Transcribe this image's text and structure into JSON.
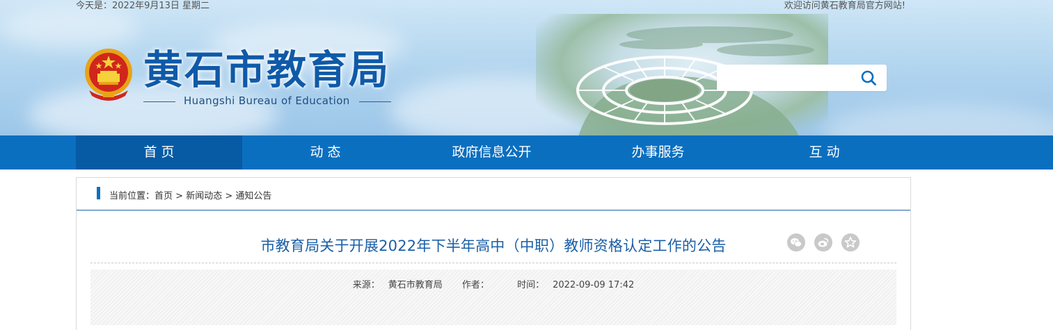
{
  "header": {
    "date_text": "今天是：2022年9月13日 星期二",
    "welcome_text": "欢迎访问黄石教育局官方网站!",
    "site_title": "黄石市教育局",
    "site_subtitle": "Huangshi Bureau of Education",
    "search": {
      "placeholder": "",
      "value": "",
      "icon": "search-icon"
    },
    "emblem_icon": "national-emblem-icon"
  },
  "nav": {
    "items": [
      {
        "label": "首 页",
        "active": true
      },
      {
        "label": "动 态",
        "active": false
      },
      {
        "label": "政府信息公开",
        "active": false
      },
      {
        "label": "办事服务",
        "active": false
      },
      {
        "label": "互 动",
        "active": false
      }
    ]
  },
  "breadcrumb": {
    "prefix": "当前位置：",
    "items": [
      "首页",
      "新闻动态",
      "通知公告"
    ],
    "separator": ">"
  },
  "article": {
    "title": "市教育局关于开展2022年下半年高中（中职）教师资格认定工作的公告",
    "share_icons": [
      "wechat-icon",
      "weibo-icon",
      "favorite-star-icon"
    ],
    "source_label": "来源：",
    "source_value": "黄石市教育局",
    "author_label": "作者：",
    "author_value": "",
    "time_label": "时间：",
    "time_value": "2022-09-09 17:42"
  },
  "colors": {
    "nav_bg": "#0b6fc0",
    "nav_active": "#065ba4",
    "title_blue": "#1a5fa6",
    "site_title_blue": "#0f5aa8"
  }
}
